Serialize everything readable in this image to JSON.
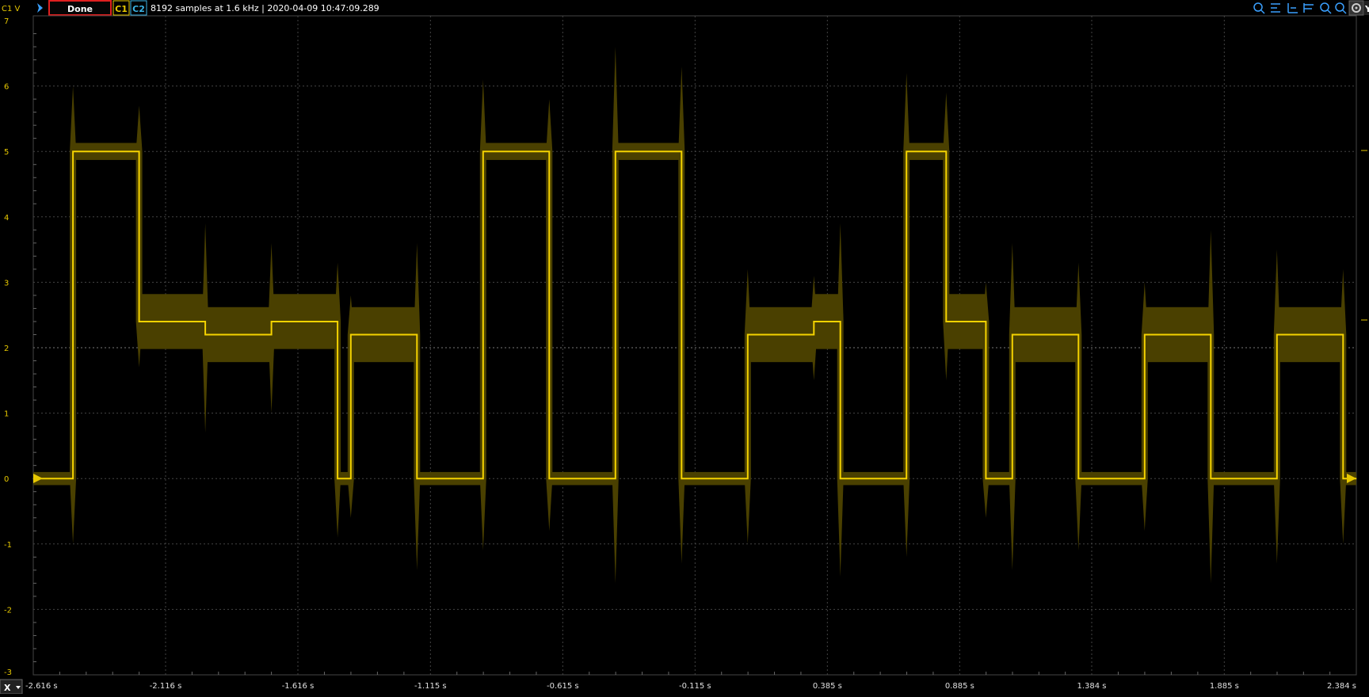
{
  "toolbar": {
    "channel_label": "C1 V",
    "status": "Done",
    "ch1": "C1",
    "ch2": "C2",
    "info": "8192 samples at 1.6 kHz | 2020-04-09 10:47:09.289",
    "right_icons": [
      "zoom-in-icon",
      "cursor-left-icon",
      "cursor-mid-icon",
      "cursor-right-icon",
      "zoom-out-icon",
      "search-icon",
      "settings-icon"
    ],
    "y_button": "Y"
  },
  "x_axis_button": "X",
  "colors": {
    "trace": "#f5d300",
    "envelope": "#4a4000",
    "grid": "#555555",
    "status_border": "#e02020",
    "ch1_color": "#e7c800",
    "ch2_color": "#3cb4e6"
  },
  "chart_data": {
    "type": "line",
    "x_unit": "s",
    "y_unit": "V",
    "xlim": [
      -2.616,
      2.384
    ],
    "ylim": [
      -3,
      7
    ],
    "x_tick_labels": [
      "-2.616 s",
      "-2.116 s",
      "-1.616 s",
      "-1.115 s",
      "-0.615 s",
      "-0.115 s",
      "0.385 s",
      "0.885 s",
      "1.384 s",
      "1.885 s",
      "2.384 s"
    ],
    "x_ticks": [
      -2.616,
      -2.116,
      -1.616,
      -1.115,
      -0.615,
      -0.115,
      0.385,
      0.885,
      1.384,
      1.885,
      2.384
    ],
    "y_ticks": [
      7,
      6,
      5,
      4,
      3,
      2,
      1,
      0,
      -1,
      -2,
      -3
    ],
    "trigger_level": 2,
    "series": [
      {
        "x": [
          -2.616,
          -2.466,
          -2.466,
          -2.216,
          -2.216,
          -1.966,
          -1.966,
          -1.716,
          -1.716,
          -1.466,
          -1.466,
          -1.416,
          -1.416,
          -1.166,
          -1.166,
          -0.916,
          -0.916,
          -0.666,
          -0.666,
          -0.416,
          -0.416,
          -0.166,
          -0.166,
          0.084,
          0.084,
          0.334,
          0.334,
          0.434,
          0.434,
          0.684,
          0.684,
          0.834,
          0.834,
          0.984,
          0.984,
          1.084,
          1.084,
          1.334,
          1.334,
          1.584,
          1.584,
          1.834,
          1.834,
          2.084,
          2.084,
          2.334,
          2.334,
          2.384
        ],
        "y": [
          0,
          0,
          5,
          5,
          2.4,
          2.4,
          2.2,
          2.2,
          2.4,
          2.4,
          0,
          0,
          2.2,
          2.2,
          0,
          0,
          5,
          5,
          0,
          0,
          5,
          5,
          0,
          0,
          2.2,
          2.2,
          2.4,
          2.4,
          0,
          0,
          5,
          5,
          2.4,
          2.4,
          0,
          0,
          2.2,
          2.2,
          0,
          0,
          2.2,
          2.2,
          0,
          0,
          2.2,
          2.2,
          0,
          0
        ]
      }
    ]
  }
}
